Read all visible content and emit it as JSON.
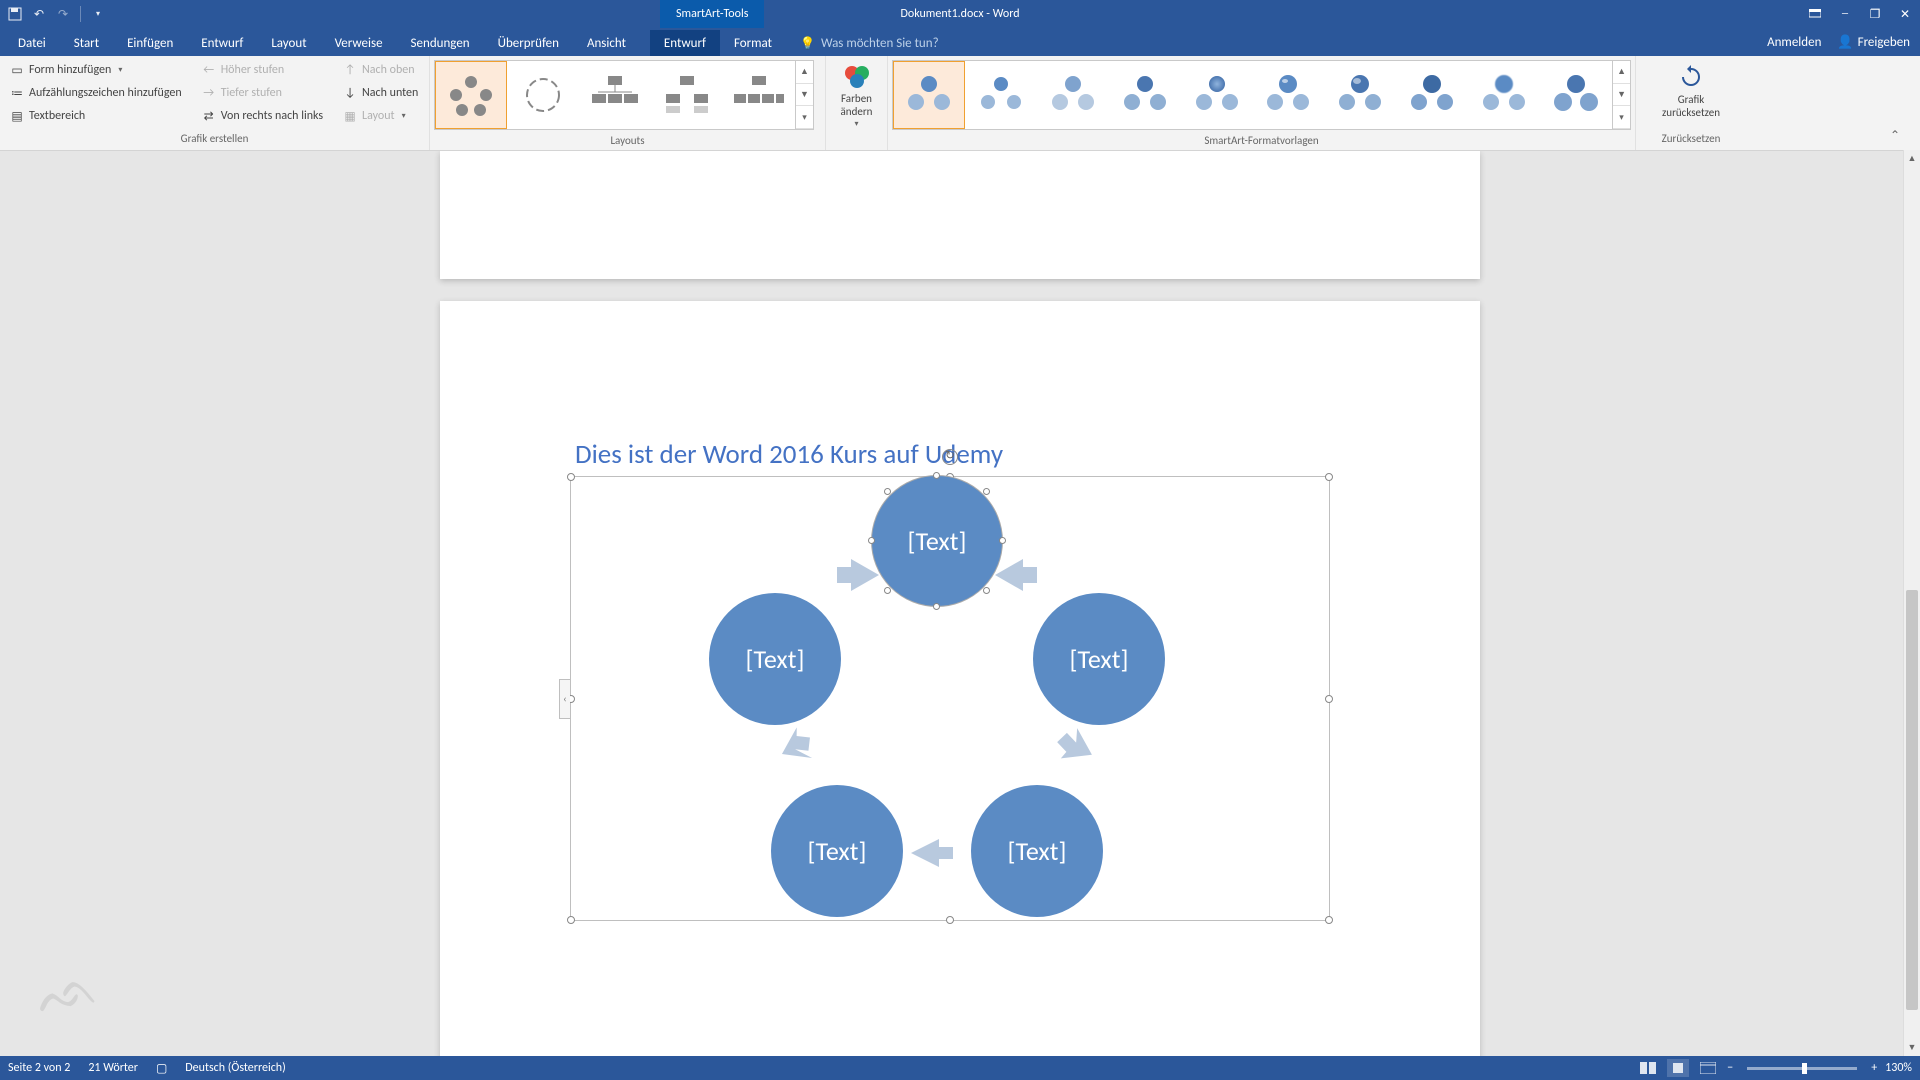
{
  "title": "Dokument1.docx - Word",
  "context_tab": "SmartArt-Tools",
  "tabs": {
    "datei": "Datei",
    "start": "Start",
    "einfuegen": "Einfügen",
    "entwurf_doc": "Entwurf",
    "layout_doc": "Layout",
    "verweise": "Verweise",
    "sendungen": "Sendungen",
    "ueberpruefen": "Überprüfen",
    "ansicht": "Ansicht",
    "entwurf": "Entwurf",
    "format": "Format",
    "tellme_placeholder": "Was möchten Sie tun?",
    "anmelden": "Anmelden",
    "freigeben": "Freigeben"
  },
  "ribbon": {
    "create": {
      "label": "Grafik erstellen",
      "add_shape": "Form hinzufügen",
      "add_bullet": "Aufzählungszeichen hinzufügen",
      "text_pane": "Textbereich",
      "promote": "Höher stufen",
      "demote": "Tiefer stufen",
      "rtl": "Von rechts nach links",
      "move_up": "Nach oben",
      "move_down": "Nach unten",
      "layout_btn": "Layout"
    },
    "layouts": {
      "label": "Layouts"
    },
    "colors": {
      "label": "Farben ändern"
    },
    "styles": {
      "label": "SmartArt-Formatvorlagen"
    },
    "reset": {
      "label": "Zurücksetzen",
      "btn": "Grafik zurücksetzen"
    }
  },
  "doc": {
    "heading": "Dies ist der Word 2016 Kurs auf Udemy",
    "nodes": [
      "[Text]",
      "[Text]",
      "[Text]",
      "[Text]",
      "[Text]"
    ]
  },
  "status": {
    "page": "Seite 2 von 2",
    "words": "21 Wörter",
    "lang": "Deutsch (Österreich)",
    "zoom": "130%"
  }
}
